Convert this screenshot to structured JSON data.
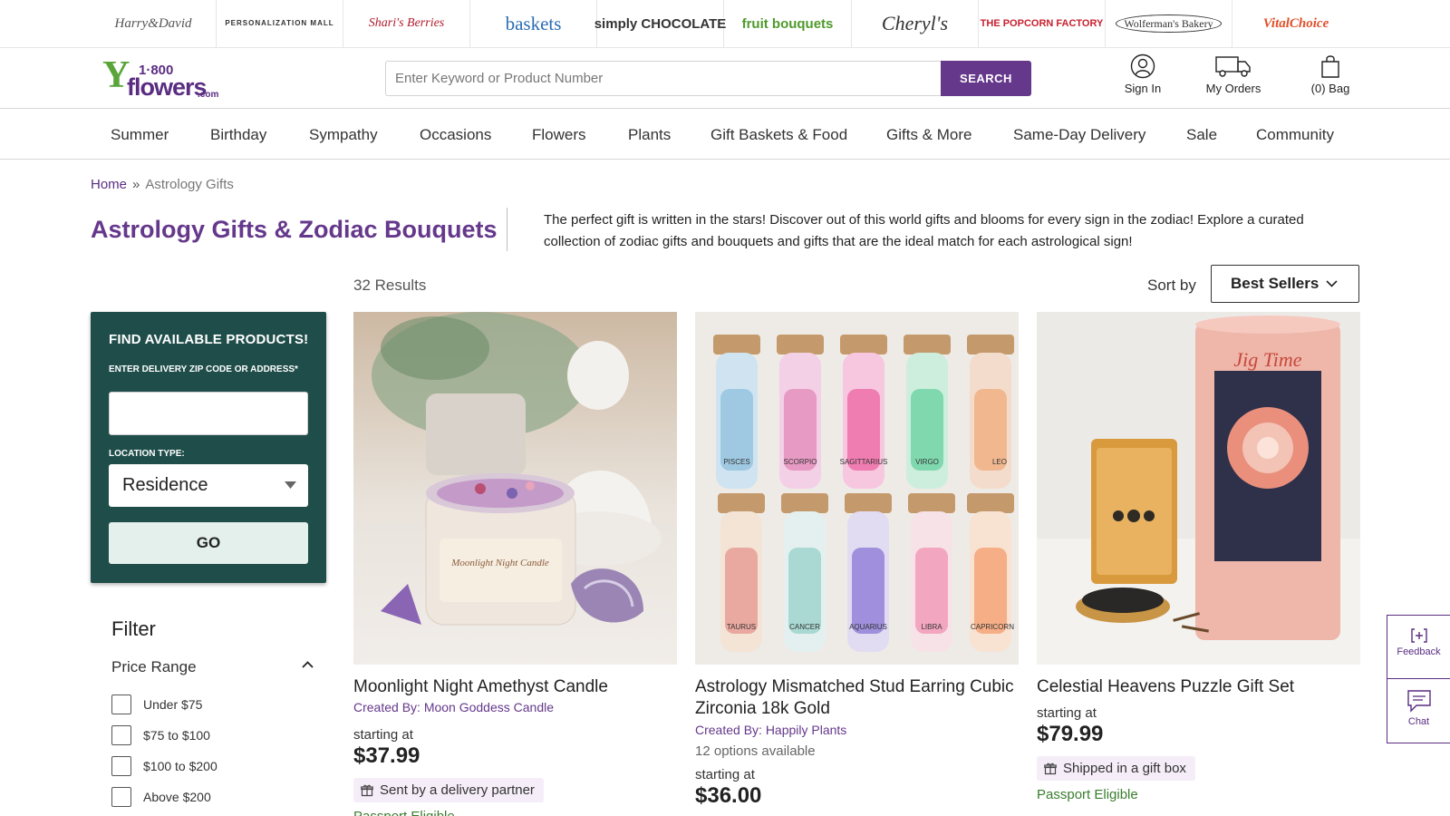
{
  "brands": [
    {
      "name": "Harry & David",
      "text": "Harry&David"
    },
    {
      "name": "Personalization Mall",
      "text": "PERSONALIZATION MALL"
    },
    {
      "name": "Shari's Berries",
      "text": "Shari's Berries"
    },
    {
      "name": "1-800-Baskets.com",
      "text": "baskets"
    },
    {
      "name": "Simply Chocolate",
      "text": "simply CHOCOLATE"
    },
    {
      "name": "Fruit Bouquets",
      "text": "fruit bouquets"
    },
    {
      "name": "Cheryl's Cookies",
      "text": "Cheryl's"
    },
    {
      "name": "The Popcorn Factory",
      "text": "THE POPCORN FACTORY"
    },
    {
      "name": "Wolferman's Bakery",
      "text": "Wolferman's Bakery"
    },
    {
      "name": "Vital Choice",
      "text": "VitalChoice"
    }
  ],
  "header": {
    "logo": {
      "num": "1·800",
      "word": "flowers",
      "com": ".com"
    },
    "search_placeholder": "Enter Keyword or Product Number",
    "search_label": "SEARCH",
    "sign_in": "Sign In",
    "my_orders": "My Orders",
    "bag": "(0) Bag"
  },
  "nav": [
    "Summer",
    "Birthday",
    "Sympathy",
    "Occasions",
    "Flowers",
    "Plants",
    "Gift Baskets & Food",
    "Gifts & More",
    "Same-Day Delivery",
    "Sale",
    "Community"
  ],
  "breadcrumb": {
    "home": "Home",
    "separator": "»",
    "current": "Astrology Gifts"
  },
  "page_title": "Astrology Gifts & Zodiac Bouquets",
  "intro": "The perfect gift is written in the stars! Discover out of this world gifts and blooms for every sign in the zodiac! Explore a curated collection of zodiac gifts and bouquets and gifts that are the ideal match for each astrological sign!",
  "results": "32 Results",
  "sort": {
    "label": "Sort by",
    "value": "Best Sellers"
  },
  "zip_panel": {
    "title": "FIND AVAILABLE PRODUCTS!",
    "zip_label": "ENTER DELIVERY ZIP CODE OR ADDRESS*",
    "zip_value": "",
    "location_label": "LOCATION TYPE:",
    "location_value": "Residence",
    "go_label": "GO"
  },
  "filter": {
    "title": "Filter",
    "price_title": "Price Range",
    "price_options": [
      "Under $75",
      "$75 to $100",
      "$100 to $200",
      "Above $200"
    ]
  },
  "products": [
    {
      "name": "Moonlight Night Amethyst Candle",
      "created_by": "Created By: Moon Goddess Candle",
      "options": "",
      "starting": "starting at",
      "price": "$37.99",
      "badge": "Sent by a delivery partner",
      "passport": "Passport Eligible",
      "candle_label": "Moonlight Night Candle"
    },
    {
      "name": "Astrology Mismatched Stud Earring Cubic Zirconia 18k Gold",
      "created_by": "Created By: Happily Plants",
      "options": "12 options available",
      "starting": "starting at",
      "price": "$36.00",
      "badge": "",
      "passport": "",
      "signs_top": [
        "PISCES",
        "SCORPIO",
        "SAGITTARIUS",
        "VIRGO",
        "LEO"
      ],
      "signs_bottom": [
        "TAURUS",
        "CANCER",
        "AQUARIUS",
        "LIBRA",
        "CAPRICORN"
      ]
    },
    {
      "name": "Celestial Heavens Puzzle Gift Set",
      "created_by": "",
      "options": "",
      "starting": "starting at",
      "price": "$79.99",
      "badge": "Shipped in a gift box",
      "passport": "Passport Eligible",
      "tube_label": "Jig Time"
    }
  ],
  "side": {
    "feedback": "Feedback",
    "chat": "Chat"
  },
  "colors": {
    "brand_purple": "#65388b",
    "panel_teal": "#1f4e4a",
    "go_button": "#e4f0ec",
    "badge_bg": "#f5edf8",
    "passport_green": "#3a7d2e"
  }
}
